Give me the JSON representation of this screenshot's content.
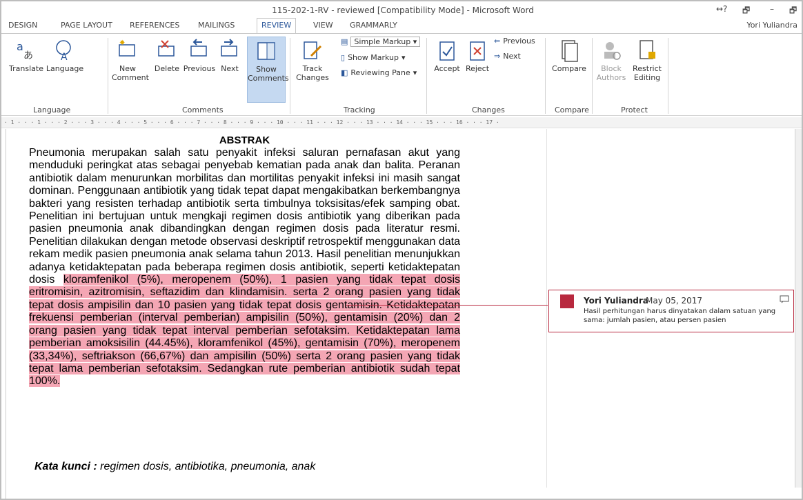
{
  "window": {
    "title": "115-202-1-RV - reviewed [Compatibility Mode] - Microsoft Word",
    "controls": [
      "↔?",
      "🗗",
      "–",
      "🗗"
    ]
  },
  "tabs": [
    "DESIGN",
    "PAGE LAYOUT",
    "REFERENCES",
    "MAILINGS",
    "REVIEW",
    "VIEW",
    "GRAMMARLY"
  ],
  "user": "Yori Yuliandra",
  "ribbon": {
    "language": {
      "translate": "Translate",
      "language": "Language",
      "group": "Language"
    },
    "comments": {
      "new": "New",
      "new2": "Comment",
      "delete": "Delete",
      "previous": "Previous",
      "next": "Next",
      "show": "Show",
      "show2": "Comments",
      "group": "Comments"
    },
    "tracking": {
      "track": "Track",
      "track2": "Changes",
      "markup_select": "Simple Markup",
      "show_markup": "Show Markup",
      "reviewing_pane": "Reviewing Pane",
      "group": "Tracking"
    },
    "changes": {
      "accept": "Accept",
      "reject": "Reject",
      "previous": "Previous",
      "next": "Next",
      "group": "Changes"
    },
    "compare": {
      "compare": "Compare",
      "group": "Compare"
    },
    "protect": {
      "block": "Block",
      "block2": "Authors",
      "restrict": "Restrict",
      "restrict2": "Editing",
      "group": "Protect"
    }
  },
  "ruler": "· 1 · · · 1 · · · 2 · · · 3 · · · 4 · · · 5 · · · 6 · · · 7 · · · 8 · · · 9 · · · 10 · · · 11 · · · 12 · · · 13 · · · 14 · · · 15 · · · 16 · · · 17 ·",
  "document": {
    "heading": "ABSTRAK",
    "body_plain": "Pneumonia merupakan salah satu penyakit infeksi saluran pernafasan akut yang menduduki peringkat atas sebagai penyebab kematian pada anak dan balita. Peranan antibiotik dalam menurunkan morbilitas dan mortilitas penyakit infeksi ini masih sangat dominan. Penggunaan antibiotik yang tidak tepat dapat mengakibatkan berkembangnya bakteri yang resisten terhadap antibiotik serta timbulnya toksisitas/efek samping obat. Penelitian ini bertujuan untuk mengkaji regimen dosis antibiotik yang diberikan pada pasien pneumonia anak dibandingkan dengan regimen dosis pada literatur resmi. Penelitian dilakukan dengan metode observasi deskriptif retrospektif menggunakan data rekam medik pasien pneumonia anak selama tahun 2013. Hasil penelitian menunjukkan adanya ketidaktepatan pada beberapa regimen dosis antibiotik, seperti ketidaktepatan dosis ",
    "body_highlight": "kloramfenikol (5%), meropenem (50%), 1 pasien yang tidak tepat dosis eritromisin, azitromisin, seftazidim dan klindamisin. serta 2 orang pasien yang tidak tepat dosis ampisilin dan 10 pasien yang tidak tepat dosis gentamisin. Ketidaktepatan frekuensi pemberian (interval pemberian) ampisilin (50%), gentamisin (20%) dan 2 orang pasien yang tidak tepat interval pemberian sefotaksim. Ketidaktepatan lama pemberian amoksisilin (44.45%), kloramfenikol (45%), gentamisin (70%), meropenem (33,34%), seftriakson (66,67%) dan ampisilin (50%) serta 2 orang pasien yang tidak tepat lama pemberian sefotaksim. Sedangkan rute pemberian antibiotik sudah tepat 100%.",
    "keywords_label": "Kata kunci :",
    "keywords_text": " regimen dosis, antibiotika, pneumonia, anak"
  },
  "comment": {
    "author": "Yori Yuliandra",
    "date": "May 05, 2017",
    "text": "Hasil perhitungan harus dinyatakan dalam satuan yang sama: jumlah pasien, atau persen pasien"
  },
  "colors": {
    "accent": "#2b579a",
    "comment": "#b8283e",
    "highlight": "#f4a6b4"
  }
}
